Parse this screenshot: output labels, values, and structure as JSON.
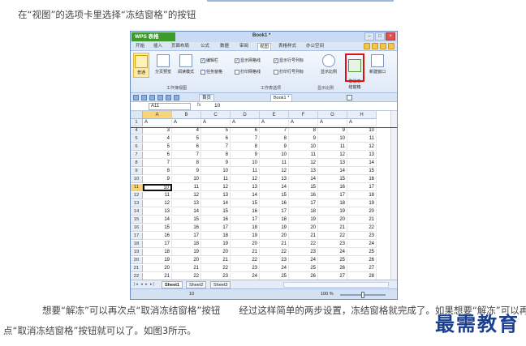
{
  "article": {
    "intro": "在“视图”的选项卡里选择“冻结窗格”的按钮",
    "outro_line1": "想要“解冻”可以再次点“取消冻结窗格”按钮　　经过这样简单的两步设置，冻结窗格就完成了。如果想要“解冻”可以再次",
    "outro_line2": "点“取消冻结窗格”按钮就可以了。如图3所示。"
  },
  "watermark": "最需教育",
  "app": {
    "logo": "WPS 表格",
    "doc_title": "Book1 *",
    "window_buttons": [
      "–",
      "□",
      "×"
    ]
  },
  "menu": {
    "tabs": [
      "开始",
      "插入",
      "页面布局",
      "公式",
      "数据",
      "审阅",
      "视图",
      "表格样式",
      "办公空间"
    ],
    "active_tab": "视图"
  },
  "ribbon": {
    "buttons": [
      {
        "label": "普通",
        "icon": "normal-view-icon"
      },
      {
        "label": "分页预览",
        "icon": "page-break-preview-icon"
      },
      {
        "label": "阅读模式",
        "icon": "reading-mode-icon"
      },
      {
        "label": "显示比例",
        "icon": "zoom-icon"
      },
      {
        "label": "取消冻\n结窗格",
        "icon": "unfreeze-panes-icon"
      },
      {
        "label": "新建窗口",
        "icon": "new-window-icon"
      }
    ],
    "checkboxes": [
      {
        "label": "编辑栏",
        "checked": true
      },
      {
        "label": "任务窗格",
        "checked": false
      },
      {
        "label": "显示网格线",
        "checked": true
      },
      {
        "label": "打印网格线",
        "checked": false
      },
      {
        "label": "显示行号列标",
        "checked": true
      },
      {
        "label": "打印行号列标",
        "checked": false
      }
    ],
    "groups": [
      "工作簿视图",
      "工作表选项",
      "显示比例"
    ]
  },
  "doc_tabs": [
    {
      "label": "首页",
      "active": false
    },
    {
      "label": "Book1 *",
      "active": true
    }
  ],
  "formula": {
    "name_box": "A11",
    "fx": "fx",
    "value": "10"
  },
  "grid": {
    "columns": [
      "A",
      "B",
      "C",
      "D",
      "E",
      "F",
      "G",
      "H"
    ],
    "active_column": "A",
    "active_row": "11",
    "header_row_label": "1",
    "header_row_cells": [
      "A",
      "A",
      "A",
      "A",
      "A",
      "A",
      "A",
      "A"
    ],
    "rows": [
      {
        "num": "4",
        "cells": [
          "3",
          "4",
          "5",
          "6",
          "7",
          "8",
          "9",
          "10"
        ]
      },
      {
        "num": "5",
        "cells": [
          "4",
          "5",
          "6",
          "7",
          "8",
          "9",
          "10",
          "11"
        ]
      },
      {
        "num": "6",
        "cells": [
          "5",
          "6",
          "7",
          "8",
          "9",
          "10",
          "11",
          "12"
        ]
      },
      {
        "num": "7",
        "cells": [
          "6",
          "7",
          "8",
          "9",
          "10",
          "11",
          "12",
          "13"
        ]
      },
      {
        "num": "8",
        "cells": [
          "7",
          "8",
          "9",
          "10",
          "11",
          "12",
          "13",
          "14"
        ]
      },
      {
        "num": "9",
        "cells": [
          "8",
          "9",
          "10",
          "11",
          "12",
          "13",
          "14",
          "15"
        ]
      },
      {
        "num": "10",
        "cells": [
          "9",
          "10",
          "11",
          "12",
          "13",
          "14",
          "15",
          "16"
        ]
      },
      {
        "num": "11",
        "cells": [
          "10",
          "11",
          "12",
          "13",
          "14",
          "15",
          "16",
          "17"
        ]
      },
      {
        "num": "12",
        "cells": [
          "11",
          "12",
          "13",
          "14",
          "15",
          "16",
          "17",
          "18"
        ]
      },
      {
        "num": "13",
        "cells": [
          "12",
          "13",
          "14",
          "15",
          "16",
          "17",
          "18",
          "19"
        ]
      },
      {
        "num": "14",
        "cells": [
          "13",
          "14",
          "15",
          "16",
          "17",
          "18",
          "19",
          "20"
        ]
      },
      {
        "num": "15",
        "cells": [
          "14",
          "15",
          "16",
          "17",
          "18",
          "19",
          "20",
          "21"
        ]
      },
      {
        "num": "16",
        "cells": [
          "15",
          "16",
          "17",
          "18",
          "19",
          "20",
          "21",
          "22"
        ]
      },
      {
        "num": "17",
        "cells": [
          "16",
          "17",
          "18",
          "19",
          "20",
          "21",
          "22",
          "23"
        ]
      },
      {
        "num": "18",
        "cells": [
          "17",
          "18",
          "19",
          "20",
          "21",
          "22",
          "23",
          "24"
        ]
      },
      {
        "num": "19",
        "cells": [
          "18",
          "19",
          "20",
          "21",
          "22",
          "23",
          "24",
          "25"
        ]
      },
      {
        "num": "20",
        "cells": [
          "19",
          "20",
          "21",
          "22",
          "23",
          "24",
          "25",
          "26"
        ]
      },
      {
        "num": "21",
        "cells": [
          "20",
          "21",
          "22",
          "23",
          "24",
          "25",
          "26",
          "27"
        ]
      },
      {
        "num": "22",
        "cells": [
          "21",
          "22",
          "23",
          "24",
          "25",
          "26",
          "27",
          "28"
        ]
      }
    ]
  },
  "sheets": [
    {
      "label": "Sheet1",
      "active": true
    },
    {
      "label": "Sheet2",
      "active": false
    },
    {
      "label": "Sheet3",
      "active": false
    }
  ],
  "status": {
    "value": "10",
    "zoom": "100 %"
  },
  "colors": {
    "accent_green": "#3e9a2b",
    "highlight_red": "#e01010",
    "active_header": "#f8d57a",
    "watermark_blue": "#1a3f8f"
  }
}
